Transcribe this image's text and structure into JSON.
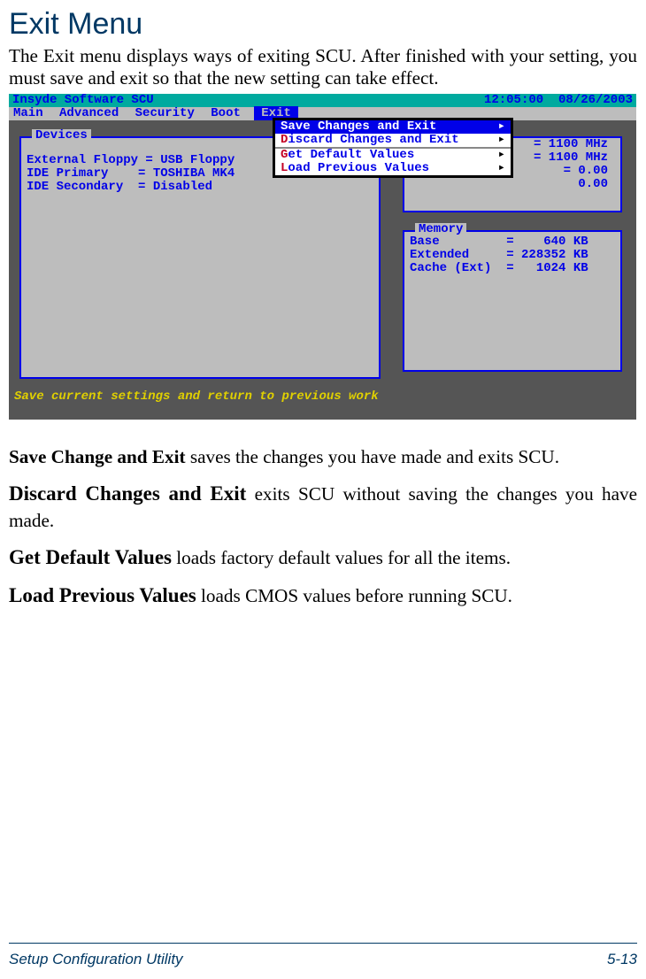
{
  "page": {
    "title": "Exit Menu",
    "intro": "The Exit menu displays ways of exiting SCU. After finished with your setting, you must save and exit so that the new setting can take effect."
  },
  "bios": {
    "title": "Insyde Software SCU",
    "time": "12:05:00",
    "date": "08/26/2003",
    "menubar": {
      "items": [
        "Main",
        "Advanced",
        "Security",
        "Boot"
      ],
      "selected": "Exit"
    },
    "devices": {
      "title": "Devices",
      "lines": [
        "External Floppy = USB Floppy",
        "IDE Primary    = TOSHIBA MK4",
        "IDE Secondary  = Disabled"
      ]
    },
    "cpu_panel": {
      "lines": [
        "= 1100 MHz",
        "= 1100 MHz",
        "= 0.00",
        "  0.00"
      ]
    },
    "memory": {
      "title": "Memory",
      "lines": [
        "Base         =    640 KB",
        "Extended     = 228352 KB",
        "Cache (Ext)  =   1024 KB"
      ]
    },
    "dropdown": {
      "rows": [
        {
          "hot": "S",
          "rest": "ave Changes and Exit",
          "selected": true
        },
        {
          "hot": "D",
          "rest": "iscard Changes and Exit",
          "selected": false
        }
      ],
      "rows2": [
        {
          "hot": "G",
          "rest": "et Default Values",
          "selected": false
        },
        {
          "hot": "L",
          "rest": "oad Previous Values",
          "selected": false
        }
      ]
    },
    "help": "Save current settings and return to previous work"
  },
  "descs": [
    {
      "bold": "Save Change and Exit",
      "rest": " saves the changes you have made and exits SCU.",
      "big": false
    },
    {
      "bold": "Discard Changes and Exit",
      "rest": " exits SCU without saving the changes you have made.",
      "big": true
    },
    {
      "bold": "Get Default Values",
      "rest": " loads factory default values for all the items.",
      "big": true
    },
    {
      "bold": "Load Previous Values",
      "rest": " loads CMOS values before running SCU.",
      "big": true
    }
  ],
  "footer": {
    "left": "Setup Configuration Utility",
    "right": "5-13"
  }
}
